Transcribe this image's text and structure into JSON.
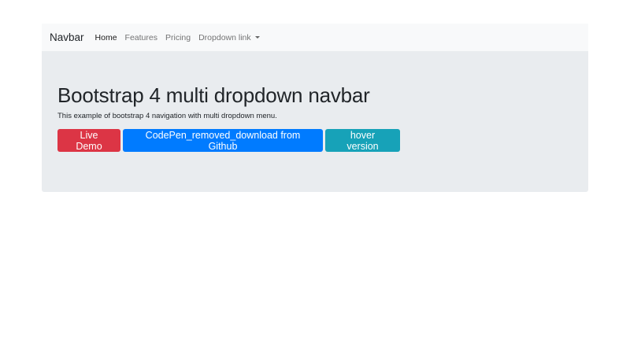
{
  "navbar": {
    "brand": "Navbar",
    "items": [
      {
        "label": "Home",
        "active": true
      },
      {
        "label": "Features",
        "active": false
      },
      {
        "label": "Pricing",
        "active": false
      },
      {
        "label": "Dropdown link",
        "active": false,
        "dropdown": true
      }
    ]
  },
  "jumbotron": {
    "title": "Bootstrap 4 multi dropdown navbar",
    "text": "This example of bootstrap 4 navigation with multi dropdown menu.",
    "buttons": [
      {
        "label": "Live Demo",
        "color": "#dc3545"
      },
      {
        "label": "CodePen_removed_download from Github",
        "color": "#007bff"
      },
      {
        "label": "hover version",
        "color": "#17a2b8"
      }
    ]
  },
  "colors": {
    "navbar_bg": "#f8f9fa",
    "jumbotron_bg": "#e9ecef"
  }
}
